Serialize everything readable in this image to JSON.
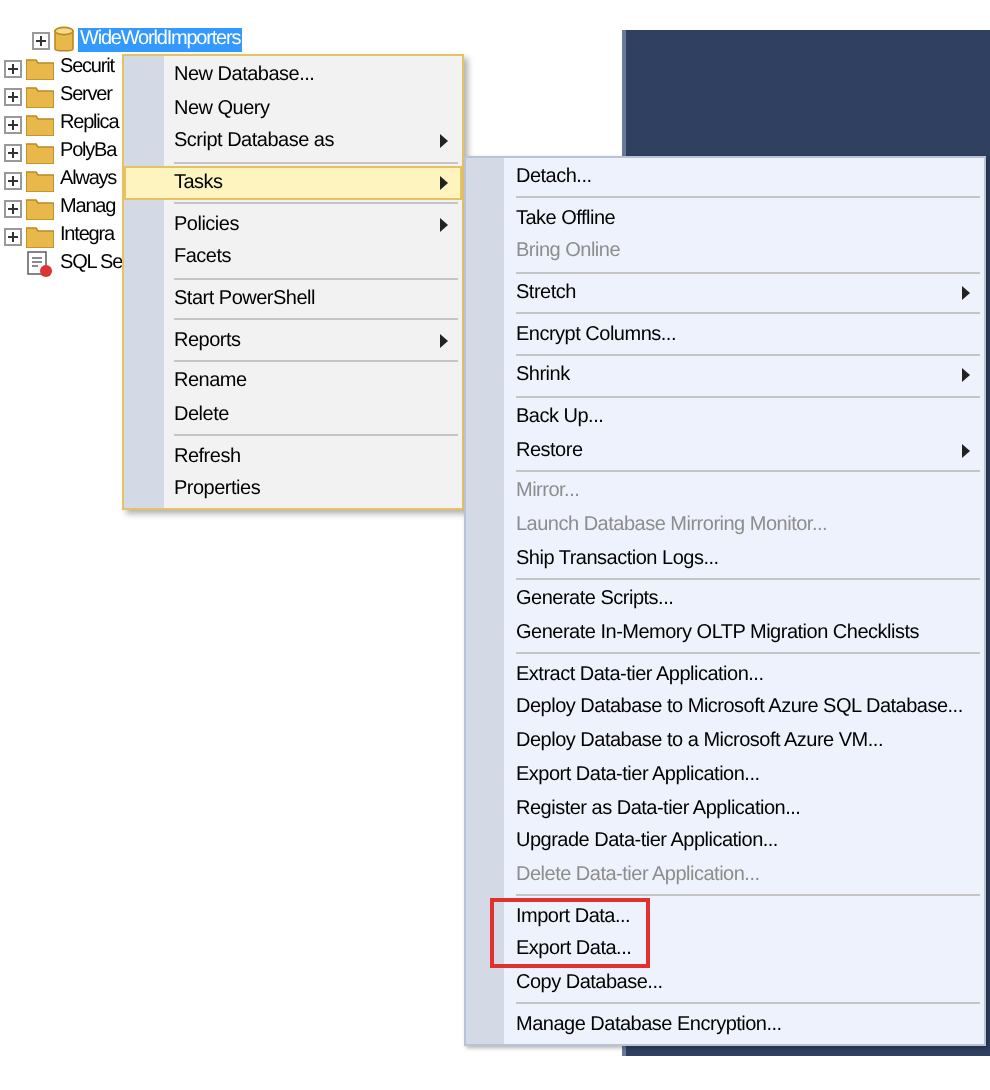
{
  "tree": {
    "nodes": [
      {
        "label": "WideWorldImporters",
        "kind": "database",
        "selected": true
      },
      {
        "label": "Securit",
        "kind": "folder",
        "selected": false
      },
      {
        "label": "Server",
        "kind": "folder",
        "selected": false
      },
      {
        "label": "Replica",
        "kind": "folder",
        "selected": false
      },
      {
        "label": "PolyBa",
        "kind": "folder",
        "selected": false
      },
      {
        "label": "Always",
        "kind": "folder",
        "selected": false
      },
      {
        "label": "Manag",
        "kind": "folder",
        "selected": false
      },
      {
        "label": "Integra",
        "kind": "folder",
        "selected": false
      },
      {
        "label": "SQL Se",
        "kind": "agent",
        "selected": false
      }
    ]
  },
  "context_menu": {
    "sections": [
      [
        {
          "label": "New Database...",
          "submenu": false,
          "selected": false
        },
        {
          "label": "New Query",
          "submenu": false,
          "selected": false
        },
        {
          "label": "Script Database as",
          "submenu": true,
          "selected": false
        }
      ],
      [
        {
          "label": "Tasks",
          "submenu": true,
          "selected": true
        }
      ],
      [
        {
          "label": "Policies",
          "submenu": true,
          "selected": false
        },
        {
          "label": "Facets",
          "submenu": false,
          "selected": false
        }
      ],
      [
        {
          "label": "Start PowerShell",
          "submenu": false,
          "selected": false
        }
      ],
      [
        {
          "label": "Reports",
          "submenu": true,
          "selected": false
        }
      ],
      [
        {
          "label": "Rename",
          "submenu": false,
          "selected": false
        },
        {
          "label": "Delete",
          "submenu": false,
          "selected": false
        }
      ],
      [
        {
          "label": "Refresh",
          "submenu": false,
          "selected": false
        },
        {
          "label": "Properties",
          "submenu": false,
          "selected": false
        }
      ]
    ]
  },
  "tasks_submenu": {
    "sections": [
      [
        {
          "label": "Detach...",
          "submenu": false,
          "disabled": false,
          "marked": false
        }
      ],
      [
        {
          "label": "Take Offline",
          "submenu": false,
          "disabled": false,
          "marked": false
        },
        {
          "label": "Bring Online",
          "submenu": false,
          "disabled": true,
          "marked": false
        }
      ],
      [
        {
          "label": "Stretch",
          "submenu": true,
          "disabled": false,
          "marked": false
        }
      ],
      [
        {
          "label": "Encrypt Columns...",
          "submenu": false,
          "disabled": false,
          "marked": false
        }
      ],
      [
        {
          "label": "Shrink",
          "submenu": true,
          "disabled": false,
          "marked": false
        }
      ],
      [
        {
          "label": "Back Up...",
          "submenu": false,
          "disabled": false,
          "marked": false
        },
        {
          "label": "Restore",
          "submenu": true,
          "disabled": false,
          "marked": false
        }
      ],
      [
        {
          "label": "Mirror...",
          "submenu": false,
          "disabled": true,
          "marked": false
        },
        {
          "label": "Launch Database Mirroring Monitor...",
          "submenu": false,
          "disabled": true,
          "marked": false
        },
        {
          "label": "Ship Transaction Logs...",
          "submenu": false,
          "disabled": false,
          "marked": false
        }
      ],
      [
        {
          "label": "Generate Scripts...",
          "submenu": false,
          "disabled": false,
          "marked": false
        },
        {
          "label": "Generate In-Memory OLTP Migration Checklists",
          "submenu": false,
          "disabled": false,
          "marked": false
        }
      ],
      [
        {
          "label": "Extract Data-tier Application...",
          "submenu": false,
          "disabled": false,
          "marked": false
        },
        {
          "label": "Deploy Database to Microsoft Azure SQL Database...",
          "submenu": false,
          "disabled": false,
          "marked": false
        },
        {
          "label": "Deploy Database to a Microsoft Azure VM...",
          "submenu": false,
          "disabled": false,
          "marked": false
        },
        {
          "label": "Export Data-tier Application...",
          "submenu": false,
          "disabled": false,
          "marked": false
        },
        {
          "label": "Register as Data-tier Application...",
          "submenu": false,
          "disabled": false,
          "marked": false
        },
        {
          "label": "Upgrade Data-tier Application...",
          "submenu": false,
          "disabled": false,
          "marked": false
        },
        {
          "label": "Delete Data-tier Application...",
          "submenu": false,
          "disabled": true,
          "marked": false
        }
      ],
      [
        {
          "label": "Import Data...",
          "submenu": false,
          "disabled": false,
          "marked": true
        },
        {
          "label": "Export Data...",
          "submenu": false,
          "disabled": false,
          "marked": true
        },
        {
          "label": "Copy Database...",
          "submenu": false,
          "disabled": false,
          "marked": false
        }
      ],
      [
        {
          "label": "Manage Database Encryption...",
          "submenu": false,
          "disabled": false,
          "marked": false
        }
      ]
    ]
  }
}
